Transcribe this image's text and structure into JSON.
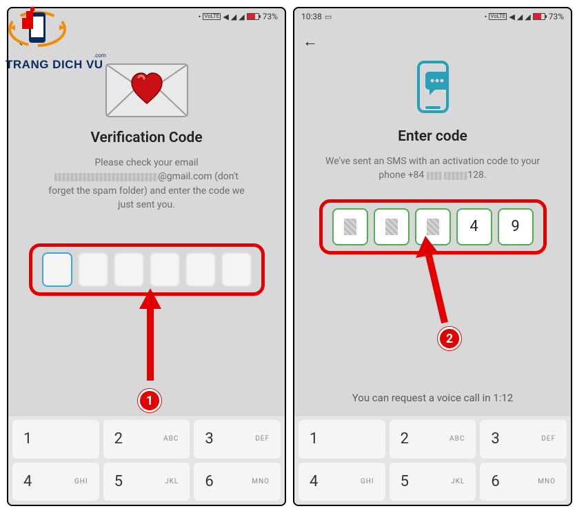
{
  "watermark": {
    "line": "TRANG DICH VU",
    "suffix": ".com"
  },
  "status": {
    "time": "10:38",
    "battery_pct": "73%"
  },
  "left": {
    "title": "Verification Code",
    "sub_pre": "Please check your email",
    "sub_email_tail": "@gmail.com (don't",
    "sub_line2": "forget the spam folder) and enter the code we",
    "sub_line3": "just sent you."
  },
  "right": {
    "title": "Enter code",
    "sub_line1": "We've sent an SMS with an activation code to your",
    "sub_phone_pre": "phone +84",
    "sub_phone_tail": "128.",
    "code4": "4",
    "code5": "9",
    "voice_line_pre": "You can request a voice call in",
    "voice_timer": "1:12"
  },
  "keypad": {
    "k1": {
      "n": "1",
      "l": ""
    },
    "k2": {
      "n": "2",
      "l": "ABC"
    },
    "k3": {
      "n": "3",
      "l": "DEF"
    },
    "k4": {
      "n": "4",
      "l": "GHI"
    },
    "k5": {
      "n": "5",
      "l": "JKL"
    },
    "k6": {
      "n": "6",
      "l": "MNO"
    }
  },
  "annot": {
    "one": "1",
    "two": "2"
  }
}
